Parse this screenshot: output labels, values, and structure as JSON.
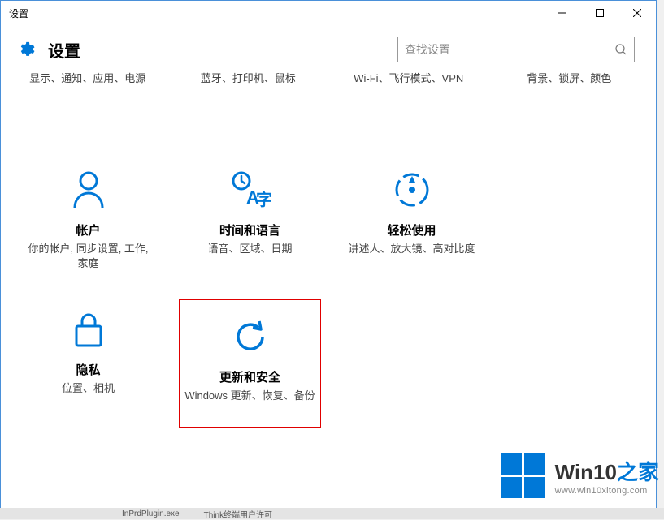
{
  "titlebar": {
    "title": "设置"
  },
  "header": {
    "title": "设置"
  },
  "search": {
    "placeholder": "查找设置"
  },
  "sub_labels": {
    "system": "显示、通知、应用、电源",
    "devices": "蓝牙、打印机、鼠标",
    "network": "Wi-Fi、飞行模式、VPN",
    "personalization": "背景、锁屏、颜色"
  },
  "categories": [
    {
      "key": "accounts",
      "title": "帐户",
      "desc": "你的帐户, 同步设置, 工作, 家庭"
    },
    {
      "key": "time_lang",
      "title": "时间和语言",
      "desc": "语音、区域、日期"
    },
    {
      "key": "ease",
      "title": "轻松使用",
      "desc": "讲述人、放大镜、高对比度"
    },
    {
      "key": "privacy",
      "title": "隐私",
      "desc": "位置、相机"
    },
    {
      "key": "update",
      "title": "更新和安全",
      "desc": "Windows 更新、恢复、备份",
      "highlight": true
    }
  ],
  "watermark": {
    "brand_pre": "Win10",
    "brand_accent": "之家",
    "url": "www.win10xitong.com"
  },
  "bottom": {
    "left": "InPrdPlugin.exe",
    "right": "Think终端用户许可"
  }
}
